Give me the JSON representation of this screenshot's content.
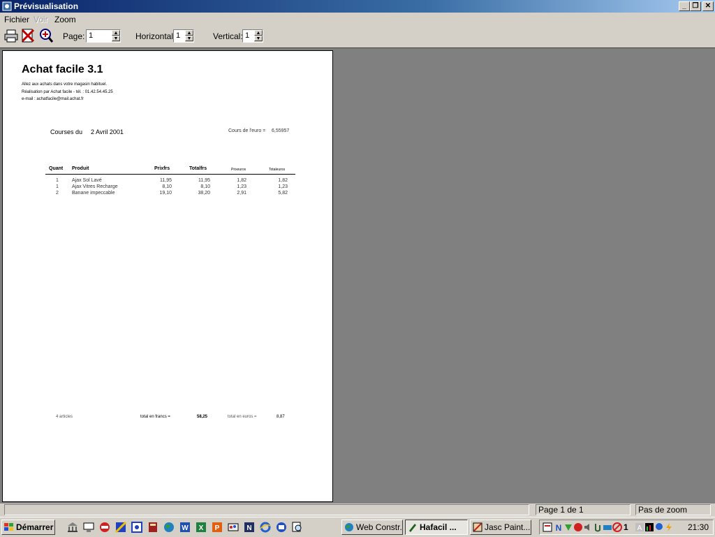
{
  "window": {
    "title": "Prévisualisation",
    "minimize": "_",
    "restore": "❐",
    "close": "✕"
  },
  "menu": {
    "items": [
      "Fichier",
      "Voir",
      "Zoom"
    ]
  },
  "toolbar": {
    "page_label": "Page:",
    "page_value": "1",
    "horizontal_label": "Horizontal:",
    "horizontal_value": "1",
    "vertical_label": "Vertical:",
    "vertical_value": "1"
  },
  "document": {
    "title": "Achat facile 3.1",
    "line1": "Allez aux achats dans votre magasin habituel.",
    "line2": "Réalisation par Achat facile - tél. : 01.42.54.45.25",
    "line3": "e-mail : achatfacile@mail.achat.fr",
    "courses_label": "Courses du",
    "courses_date": "2 Avril 2001",
    "rate_label": "Cours de l'euro =",
    "rate_value": "6,55957",
    "headers": [
      "Quant",
      "Produit",
      "Prixfrs",
      "Totalfrs",
      "Prixeuros",
      "Totaleuros"
    ],
    "rows": [
      [
        "1",
        "Ajax Sol Lavé",
        "11,95",
        "11,95",
        "1,82",
        "1,82"
      ],
      [
        "1",
        "Ajax Vitres Recharge",
        "8,10",
        "8,10",
        "1,23",
        "1,23"
      ],
      [
        "2",
        "Banane impeccable",
        "19,10",
        "38,20",
        "2,91",
        "5,82"
      ]
    ],
    "footer": {
      "items_label": "4 articles",
      "total_francs_label": "total en francs =",
      "total_francs": "58,25",
      "total_euros_label": "total en euros =",
      "total_euros": "8,87"
    }
  },
  "status": {
    "page": "Page 1 de 1",
    "zoom": "Pas de zoom"
  },
  "taskbar": {
    "start": "Démarrer",
    "tasks": [
      "Web Constr...",
      "Hafacil ...",
      "Jasc Paint..."
    ],
    "clock": "21:30",
    "tray_number": "1"
  }
}
